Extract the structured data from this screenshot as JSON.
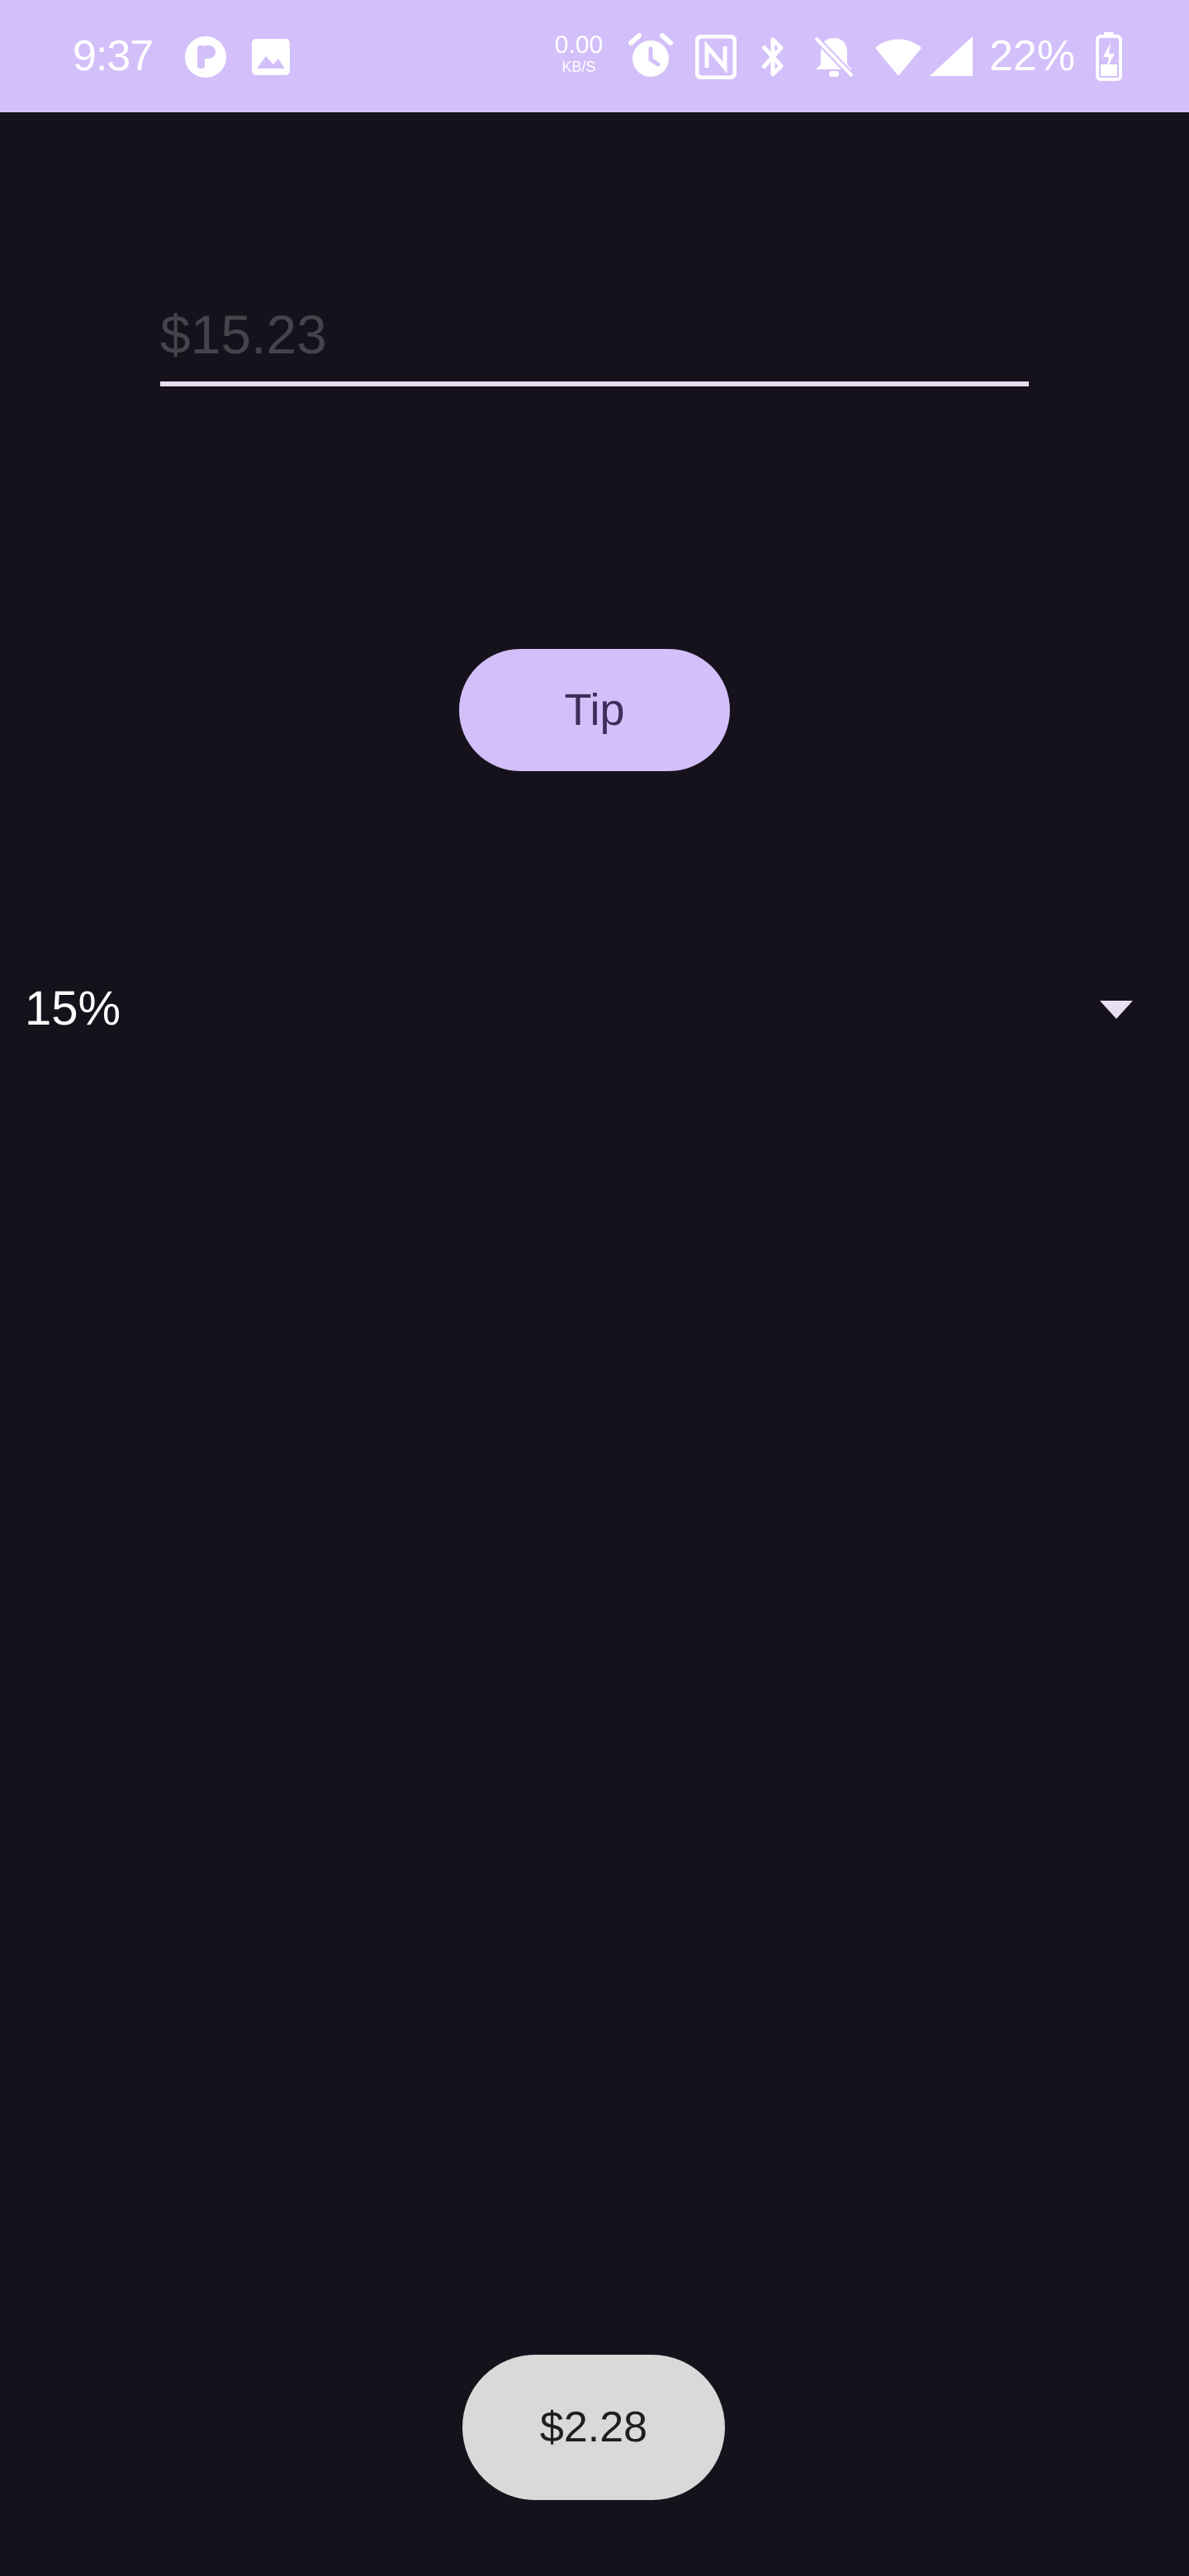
{
  "status_bar": {
    "time": "9:37",
    "net_speed_value": "0.00",
    "net_speed_unit": "KB/S",
    "battery_percent": "22%",
    "icons": [
      "app-notification-icon",
      "image-icon",
      "alarm-icon",
      "nfc-icon",
      "bluetooth-icon",
      "notifications-off-icon",
      "wifi-icon",
      "cell-signal-icon",
      "battery-charging-icon"
    ],
    "background": "#d3bffa"
  },
  "amount_input": {
    "placeholder": "$15.23",
    "value": ""
  },
  "tip_button": {
    "label": "Tip"
  },
  "tip_percent": {
    "selected": "15%"
  },
  "result": {
    "label": "$2.28"
  },
  "colors": {
    "background": "#16121b",
    "accent": "#d3bffa",
    "result_chip": "#d9d9d9"
  }
}
